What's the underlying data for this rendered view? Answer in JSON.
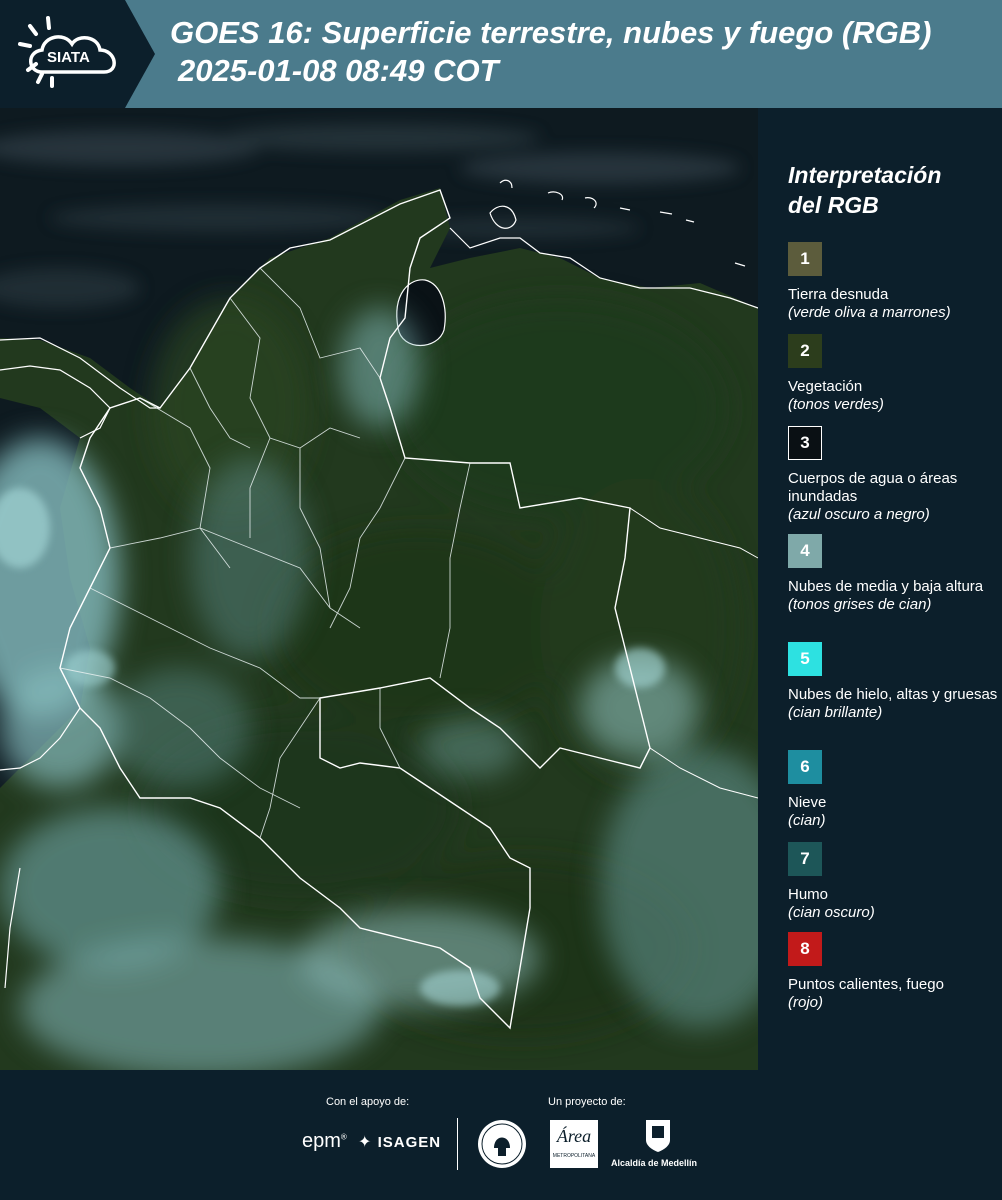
{
  "header": {
    "title_line1": "GOES 16: Superficie terrestre, nubes y fuego (RGB)",
    "title_line2": "2025-01-08 08:49 COT",
    "logo_text": "SIATA"
  },
  "legend": {
    "title_line1": "Interpretación",
    "title_line2": "del RGB",
    "items": [
      {
        "num": "1",
        "label": "Tierra desnuda",
        "desc": "(verde oliva a marrones)",
        "color": "#5c5c3c",
        "text_color": "#ffffff"
      },
      {
        "num": "2",
        "label": "Vegetación",
        "desc": "(tonos verdes)",
        "color": "#2c3d1c",
        "text_color": "#ffffff"
      },
      {
        "num": "3",
        "label": "Cuerpos de agua o áreas inundadas",
        "desc": "(azul oscuro a negro)",
        "color": "#0a1014",
        "text_color": "#ffffff"
      },
      {
        "num": "4",
        "label": "Nubes de media y baja altura",
        "desc": "(tonos grises de cian)",
        "color": "#7fa9a9",
        "text_color": "#ffffff"
      },
      {
        "num": "5",
        "label": "Nubes de hielo, altas y gruesas",
        "desc": "(cian brillante)",
        "color": "#2de1e1",
        "text_color": "#ffffff"
      },
      {
        "num": "6",
        "label": "Nieve",
        "desc": "(cian)",
        "color": "#1e8ea0",
        "text_color": "#ffffff"
      },
      {
        "num": "7",
        "label": "Humo",
        "desc": "(cian oscuro)",
        "color": "#1d5658",
        "text_color": "#ffffff"
      },
      {
        "num": "8",
        "label": "Puntos calientes, fuego",
        "desc": "(rojo)",
        "color": "#c21a1a",
        "text_color": "#ffffff"
      }
    ]
  },
  "footer": {
    "support_label": "Con el apoyo de:",
    "project_label": "Un proyecto de:",
    "epm": "epm",
    "isagen": "ISAGEN",
    "metro_text": "Área",
    "metro_sub": "METROPOLITANA",
    "alcaldia": "Alcaldía de Medellín"
  },
  "colors": {
    "header_bg": "#4b7b8c",
    "page_bg": "#0c1f2b",
    "land": "#24401f",
    "cloud": "#7fb6b6",
    "ocean": "#101c22"
  }
}
